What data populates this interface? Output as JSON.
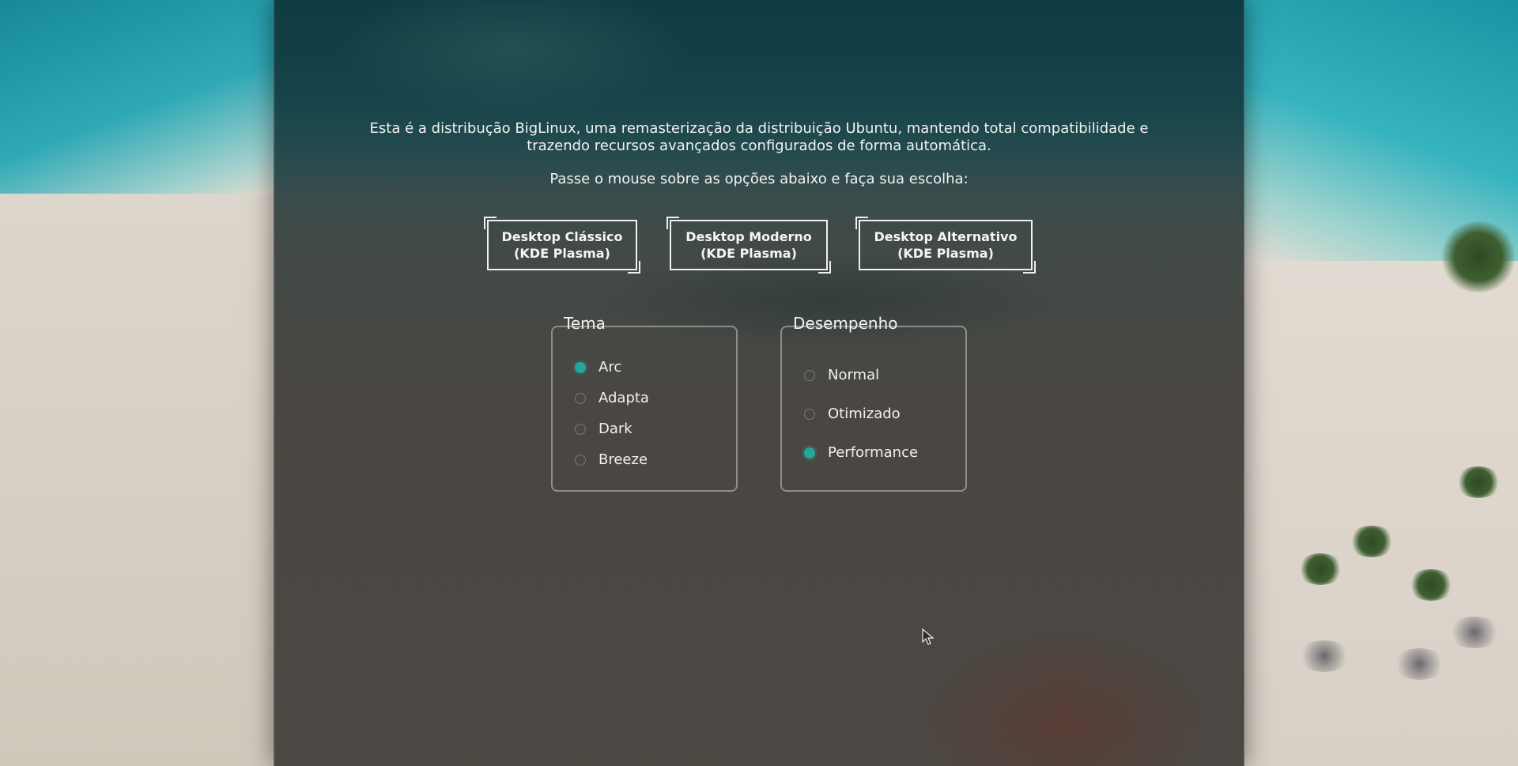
{
  "intro": {
    "description": "Esta é a distribução BigLinux, uma remasterização da distribuição Ubuntu, mantendo total compatibilidade e trazendo recursos avançados configurados de forma automática.",
    "hint": "Passe o mouse sobre as opções abaixo e faça sua escolha:"
  },
  "desktops": [
    {
      "line1": "Desktop Clássico",
      "line2": "(KDE Plasma)"
    },
    {
      "line1": "Desktop Moderno",
      "line2": "(KDE Plasma)"
    },
    {
      "line1": "Desktop Alternativo",
      "line2": "(KDE Plasma)"
    }
  ],
  "theme": {
    "title": "Tema",
    "options": [
      "Arc",
      "Adapta",
      "Dark",
      "Breeze"
    ],
    "selected": "Arc"
  },
  "performance": {
    "title": "Desempenho",
    "options": [
      "Normal",
      "Otimizado",
      "Performance"
    ],
    "selected": "Performance"
  },
  "colors": {
    "accent": "#26a69a",
    "text": "#f2f2f2"
  },
  "icons": {
    "cursor": "mouse-pointer-icon"
  }
}
